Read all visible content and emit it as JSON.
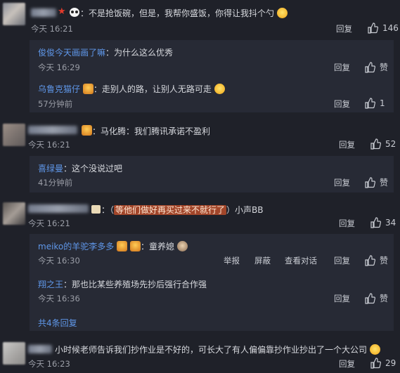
{
  "comments": [
    {
      "text": "：不是抢饭碗，但是，我帮你盛饭，你得让我抖个勺",
      "time": "今天 16:21",
      "reply_label": "回复",
      "likes": "146"
    },
    {
      "text": "：马化腾：我们腾讯承诺不盈利",
      "time": "今天 16:21",
      "reply_label": "回复",
      "likes": "52"
    },
    {
      "text_open": "：（",
      "text_highlight": "等他们做好再买过来不就行了",
      "text_close": "）小声BB",
      "time": "今天 16:21",
      "reply_label": "回复",
      "likes": "34"
    },
    {
      "text": "小时候老师告诉我们抄作业是不好的，可长大了有人偏偏靠抄作业抄出了一个大公司",
      "time": "今天 16:23",
      "reply_label": "回复",
      "likes": "29"
    }
  ],
  "replies_1": [
    {
      "name": "俊俊今天画画了嘛",
      "text": "：为什么这么优秀",
      "time": "今天 16:29",
      "reply_label": "回复",
      "like_label": "赞"
    },
    {
      "name": "乌鲁克猫仔",
      "text": "：走别人的路，让别人无路可走",
      "time": "57分钟前",
      "reply_label": "回复",
      "likes": "1"
    }
  ],
  "replies_2": [
    {
      "name": "喜绿曼",
      "text": "：这个没说过吧",
      "time": "41分钟前",
      "reply_label": "回复",
      "like_label": "赞"
    }
  ],
  "replies_3": [
    {
      "name": "meiko的羊驼李多多",
      "text": "：童养媳",
      "time": "今天 16:30",
      "report_label": "举报",
      "block_label": "屏蔽",
      "dialog_label": "查看对话",
      "reply_label": "回复",
      "like_label": "赞"
    },
    {
      "name": "翔之王",
      "text": "：那也比某些养殖场先抄后强行合作强",
      "time": "今天 16:36",
      "reply_label": "回复",
      "like_label": "赞"
    }
  ],
  "more_replies": "共4条回复",
  "colors": {
    "background": "#1f2129",
    "reply_box": "#272a35",
    "link": "#5f97e9",
    "highlight": "#a2462a"
  }
}
